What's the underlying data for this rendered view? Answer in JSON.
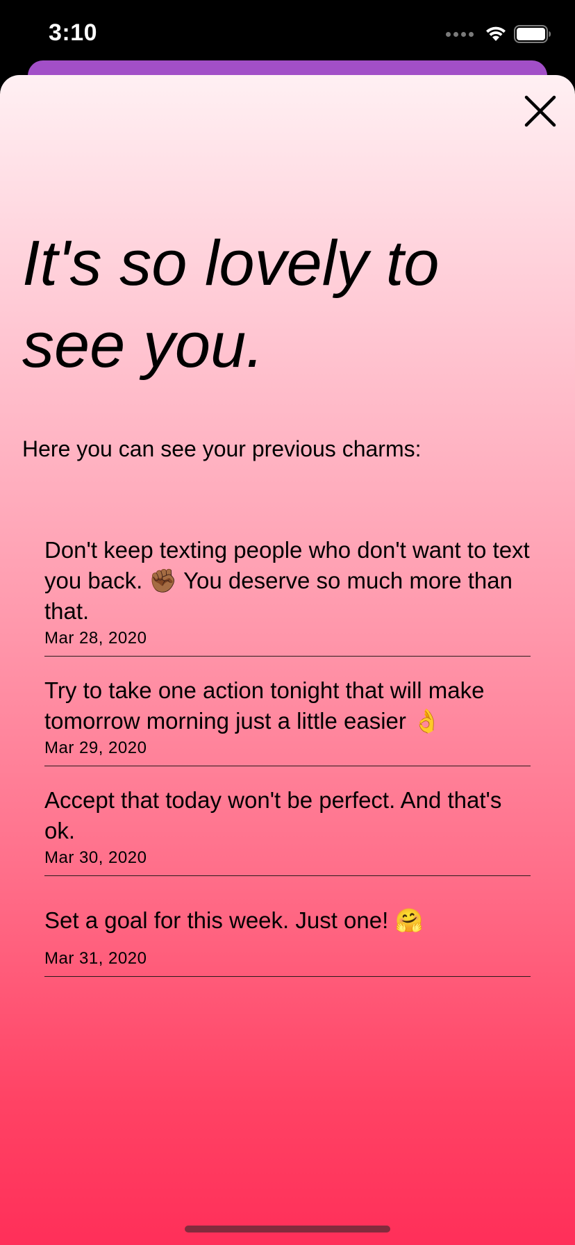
{
  "status_bar": {
    "time": "3:10"
  },
  "colors": {
    "back_sheet": "#a24fc7",
    "gradient_top": "#fff0f3",
    "gradient_bottom": "#ff2f59"
  },
  "modal": {
    "close_icon": "close-icon",
    "headline": "It's so lovely to see you.",
    "subtitle": "Here you can see your previous charms:",
    "charms": [
      {
        "text": "Don't keep texting people who don't want to text you back. ✊🏾 You deserve so much more than that.",
        "date": "Mar 28, 2020"
      },
      {
        "text": "Try to take one action tonight that will make tomorrow morning just a little easier 👌",
        "date": "Mar 29, 2020"
      },
      {
        "text": "Accept that today won't be perfect. And that's ok.",
        "date": "Mar 30, 2020"
      },
      {
        "text": "Set a goal for this week. Just one! 🤗",
        "date": "Mar 31, 2020"
      }
    ]
  }
}
